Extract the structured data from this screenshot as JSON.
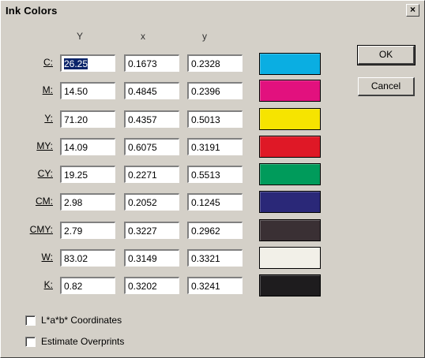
{
  "dialog": {
    "title": "Ink Colors",
    "close_label": "×"
  },
  "columns": {
    "y_upper": "Y",
    "x": "x",
    "y": "y"
  },
  "rows": [
    {
      "label": "C:",
      "Y": "26.25",
      "x": "0.1673",
      "y": "0.2328",
      "color": "#0aaee2"
    },
    {
      "label": "M:",
      "Y": "14.50",
      "x": "0.4845",
      "y": "0.2396",
      "color": "#e2117e"
    },
    {
      "label": "Y:",
      "Y": "71.20",
      "x": "0.4357",
      "y": "0.5013",
      "color": "#f6e400"
    },
    {
      "label": "MY:",
      "Y": "14.09",
      "x": "0.6075",
      "y": "0.3191",
      "color": "#df1826"
    },
    {
      "label": "CY:",
      "Y": "19.25",
      "x": "0.2271",
      "y": "0.5513",
      "color": "#009b5b"
    },
    {
      "label": "CM:",
      "Y": "2.98",
      "x": "0.2052",
      "y": "0.1245",
      "color": "#2a2878"
    },
    {
      "label": "CMY:",
      "Y": "2.79",
      "x": "0.3227",
      "y": "0.2962",
      "color": "#3a3034"
    },
    {
      "label": "W:",
      "Y": "83.02",
      "x": "0.3149",
      "y": "0.3321",
      "color": "#f2f0e8"
    },
    {
      "label": "K:",
      "Y": "0.82",
      "x": "0.3202",
      "y": "0.3241",
      "color": "#1e1c1e"
    }
  ],
  "buttons": {
    "ok": "OK",
    "cancel": "Cancel"
  },
  "options": {
    "lab": "L*a*b* Coordinates",
    "overprints": "Estimate Overprints"
  }
}
